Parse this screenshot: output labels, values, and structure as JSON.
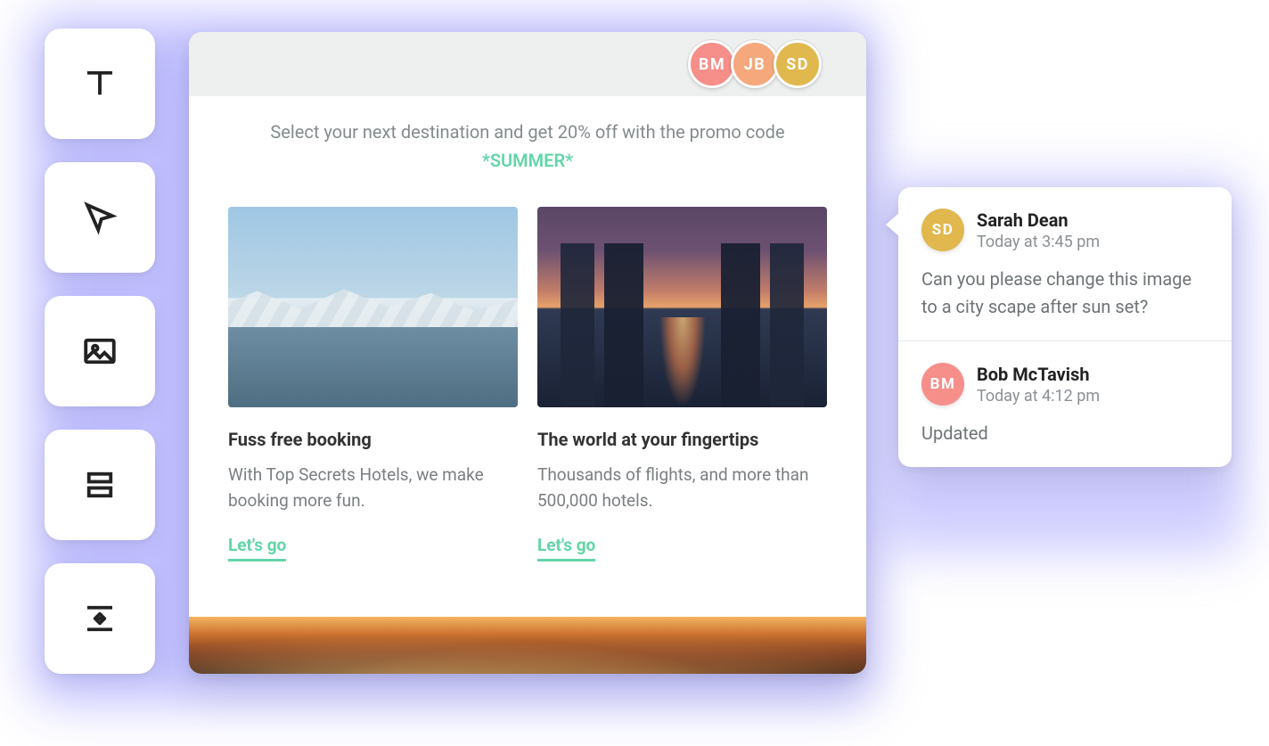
{
  "toolbar_icons": [
    "text",
    "pointer",
    "image",
    "rows",
    "spacing"
  ],
  "collaborators": [
    {
      "initials": "BM",
      "color": "c-pink"
    },
    {
      "initials": "JB",
      "color": "c-peach"
    },
    {
      "initials": "SD",
      "color": "c-gold"
    }
  ],
  "promo": {
    "line": "Select your next destination and get 20% off with the promo code",
    "code": "*SUMMER*"
  },
  "cards": [
    {
      "title": "Fuss free booking",
      "desc": "With Top Secrets Hotels, we make booking more fun.",
      "cta": "Let's go",
      "scene": "scene-mountain"
    },
    {
      "title": "The world at your fingertips",
      "desc": "Thousands of flights, and more than 500,000 hotels.",
      "cta": "Let's go",
      "scene": "scene-city"
    }
  ],
  "comments": [
    {
      "author": "Sarah Dean",
      "initials": "SD",
      "avatar_color": "c-gold",
      "time": "Today at 3:45 pm",
      "body": "Can you please change this image to a city scape after sun set?"
    },
    {
      "author": "Bob McTavish",
      "initials": "BM",
      "avatar_color": "c-pink",
      "time": "Today at 4:12 pm",
      "body": "Updated"
    }
  ]
}
